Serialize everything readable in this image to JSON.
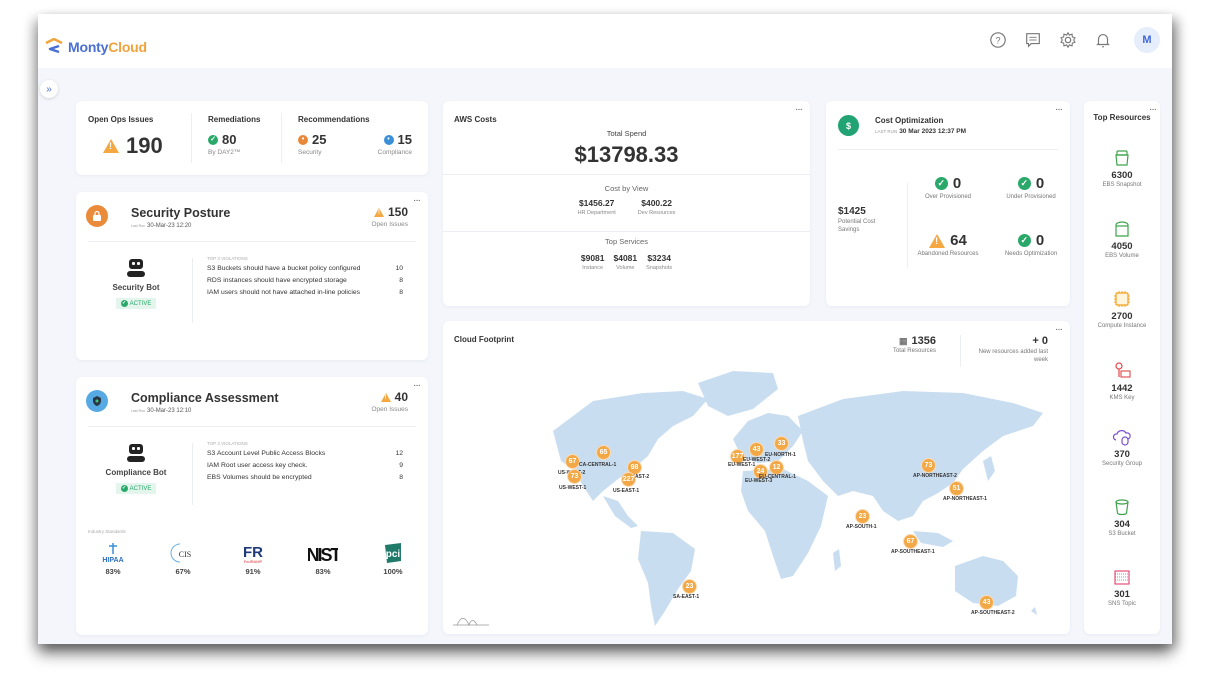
{
  "app": {
    "logo_part1": "Monty",
    "logo_part2": "Cloud",
    "avatar_initial": "M",
    "top_icons": [
      "help-icon",
      "feedback-icon",
      "settings-icon",
      "bell-icon"
    ],
    "expand_label": "»"
  },
  "ops_summary": {
    "open_ops": {
      "label": "Open Ops Issues",
      "value": "190"
    },
    "remediations": {
      "label": "Remediations",
      "value": "80",
      "sub": "By DAY2™"
    },
    "recommendations": {
      "label": "Recommendations",
      "security": {
        "value": "25",
        "sub": "Security"
      },
      "compliance": {
        "value": "15",
        "sub": "Compliance"
      }
    }
  },
  "security_posture": {
    "title": "Security Posture",
    "last_run_label": "Last Run",
    "last_run": "30-Mar-23 12:20",
    "open_issues": "150",
    "open_issues_label": "Open Issues",
    "bot_name": "Security Bot",
    "bot_status": "ACTIVE",
    "violations_header": "TOP 3 VIOLATIONS",
    "violations": [
      {
        "text": "S3 Buckets should have a bucket policy configured",
        "count": "10"
      },
      {
        "text": "RDS instances should have encrypted storage",
        "count": "8"
      },
      {
        "text": "IAM users should not have attached in-line policies",
        "count": "8"
      }
    ]
  },
  "compliance": {
    "title": "Compliance Assessment",
    "last_run_label": "Last Run",
    "last_run": "30-Mar-23 12:10",
    "open_issues": "40",
    "open_issues_label": "Open Issues",
    "bot_name": "Compliance Bot",
    "bot_status": "ACTIVE",
    "violations_header": "TOP 3 VIOLATIONS",
    "violations": [
      {
        "text": "S3 Account Level Public Access Blocks",
        "count": "12"
      },
      {
        "text": "IAM Root user access key check.",
        "count": "9"
      },
      {
        "text": "EBS Volumes should be encrypted",
        "count": "8"
      }
    ],
    "standards_header": "Industry Standards",
    "standards": [
      {
        "name": "HIPAA",
        "percent": "83%"
      },
      {
        "name": "CIS",
        "percent": "67%"
      },
      {
        "name": "FedRAMP",
        "percent": "91%"
      },
      {
        "name": "NIST",
        "percent": "83%"
      },
      {
        "name": "PCI",
        "percent": "100%"
      }
    ]
  },
  "aws_costs": {
    "title": "AWS Costs",
    "total_label": "Total Spend",
    "total_value": "$13798.33",
    "by_view_label": "Cost by View",
    "by_view": [
      {
        "value": "$1456.27",
        "label": "HR Department"
      },
      {
        "value": "$400.22",
        "label": "Dev Resources"
      }
    ],
    "top_services_label": "Top Services",
    "top_services": [
      {
        "value": "$9081",
        "label": "Instance"
      },
      {
        "value": "$4081",
        "label": "Volume"
      },
      {
        "value": "$3234",
        "label": "Snapshots"
      }
    ]
  },
  "cost_optimization": {
    "title": "Cost Optimization",
    "last_run_label": "LAST RUN",
    "last_run": "30 Mar 2023 12:37 PM",
    "savings_value": "$1425",
    "savings_label": "Potential Cost Savings",
    "metrics": [
      {
        "value": "0",
        "label": "Over Provisioned",
        "status": "ok"
      },
      {
        "value": "0",
        "label": "Under Provisioned",
        "status": "ok"
      },
      {
        "value": "64",
        "label": "Abandoned Resources",
        "status": "warn"
      },
      {
        "value": "0",
        "label": "Needs Optimization",
        "status": "ok"
      }
    ]
  },
  "top_resources": {
    "title": "Top Resources",
    "items": [
      {
        "count": "6300",
        "label": "EBS Snapshot",
        "icon": "ebs-snapshot-icon",
        "color": "#3fa34d"
      },
      {
        "count": "4050",
        "label": "EBS Volume",
        "icon": "ebs-volume-icon",
        "color": "#3fa34d"
      },
      {
        "count": "2700",
        "label": "Compute Instance",
        "icon": "compute-instance-icon",
        "color": "#f0a020"
      },
      {
        "count": "1442",
        "label": "KMS Key",
        "icon": "kms-key-icon",
        "color": "#e04848"
      },
      {
        "count": "370",
        "label": "Security Group",
        "icon": "security-group-icon",
        "color": "#7a4fd0"
      },
      {
        "count": "304",
        "label": "S3 Bucket",
        "icon": "s3-bucket-icon",
        "color": "#3fa34d"
      },
      {
        "count": "301",
        "label": "SNS Topic",
        "icon": "sns-topic-icon",
        "color": "#e0406a"
      }
    ]
  },
  "cloud_footprint": {
    "title": "Cloud Footprint",
    "total_resources": "1356",
    "total_resources_label": "Total Resources",
    "new_resources": "+ 0",
    "new_resources_label": "New resources added last week",
    "regions": [
      {
        "name": "US-WEST-2",
        "count": "67"
      },
      {
        "name": "CA-CENTRAL-1",
        "count": "65"
      },
      {
        "name": "US-WEST-1",
        "count": "73"
      },
      {
        "name": "US-EAST-2",
        "count": "98"
      },
      {
        "name": "US-EAST-1",
        "count": "227"
      },
      {
        "name": "EU-WEST-1",
        "count": "177"
      },
      {
        "name": "EU-WEST-2",
        "count": "43"
      },
      {
        "name": "EU-NORTH-1",
        "count": "33"
      },
      {
        "name": "EU-WEST-3",
        "count": "24"
      },
      {
        "name": "EU-CENTRAL-1",
        "count": "12"
      },
      {
        "name": "AP-NORTHEAST-2",
        "count": "73"
      },
      {
        "name": "AP-NORTHEAST-1",
        "count": "51"
      },
      {
        "name": "AP-SOUTH-1",
        "count": "23"
      },
      {
        "name": "AP-SOUTHEAST-1",
        "count": "67"
      },
      {
        "name": "SA-EAST-1",
        "count": "23"
      },
      {
        "name": "AP-SOUTHEAST-2",
        "count": "43"
      }
    ]
  },
  "colors": {
    "accent_orange": "#f3a848",
    "ok_green": "#2aa86a",
    "map_land": "#c9ddf1",
    "brand_blue": "#4a6fd3"
  }
}
